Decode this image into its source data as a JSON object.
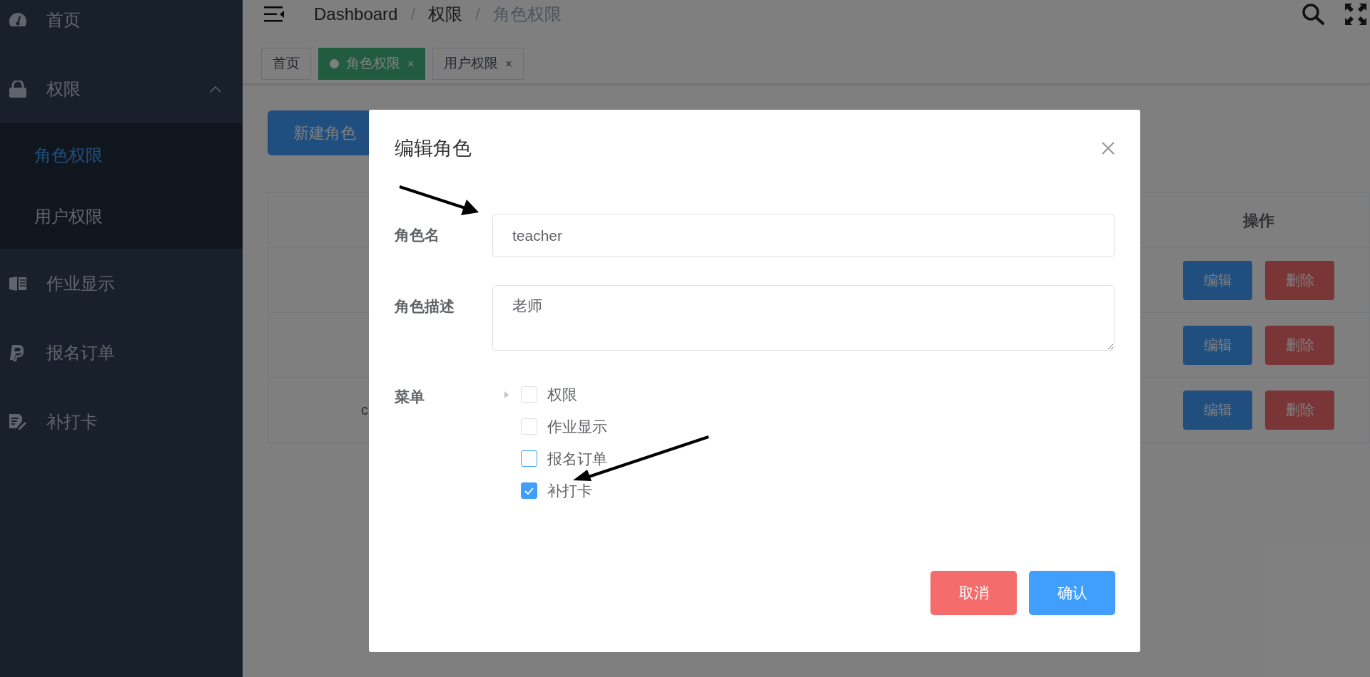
{
  "sidebar": {
    "items": [
      {
        "label": "首页",
        "selected": false
      },
      {
        "label": "权限",
        "selected": false,
        "expanded": true,
        "children": [
          {
            "label": "角色权限",
            "selected": true
          },
          {
            "label": "用户权限",
            "selected": false
          }
        ]
      },
      {
        "label": "作业显示",
        "selected": false
      },
      {
        "label": "报名订单",
        "selected": false
      },
      {
        "label": "补打卡",
        "selected": false
      }
    ]
  },
  "breadcrumb": [
    {
      "label": "Dashboard"
    },
    {
      "separator": "/",
      "label": "权限"
    },
    {
      "separator": "/",
      "label": "角色权限"
    }
  ],
  "tags": [
    {
      "label": "首页",
      "selected": false
    },
    {
      "label": "角色权限",
      "selected": true,
      "close": "×"
    },
    {
      "label": "用户权限",
      "selected": false,
      "close": "×"
    }
  ],
  "new_button": "新建角色",
  "table": {
    "columns": [
      {
        "label": "操作"
      }
    ],
    "rows": [
      {
        "actions": [
          "编辑",
          "删除"
        ]
      },
      {
        "actions": [
          "编辑",
          "删除"
        ]
      },
      {
        "column_1": "c",
        "actions": [
          "编辑",
          "删除"
        ]
      }
    ]
  },
  "dialog": {
    "title": "编辑角色",
    "fields": [
      {
        "kind": "input",
        "label": "角色名",
        "value": "teacher"
      },
      {
        "kind": "textarea",
        "label": "角色描述",
        "value": "老师"
      }
    ],
    "menu_label": "菜单",
    "menu_tree": [
      {
        "label": "权限",
        "has_children": true,
        "checked": false,
        "hovered": false
      },
      {
        "label": "作业显示",
        "has_children": false,
        "checked": false,
        "hovered": false
      },
      {
        "label": "报名订单",
        "has_children": false,
        "checked": false,
        "hovered": true
      },
      {
        "label": "补打卡",
        "has_children": false,
        "checked": true,
        "hovered": false
      }
    ],
    "buttons": [
      {
        "kind": "cancel",
        "label": "取消"
      },
      {
        "kind": "confirm",
        "label": "确认"
      }
    ]
  }
}
